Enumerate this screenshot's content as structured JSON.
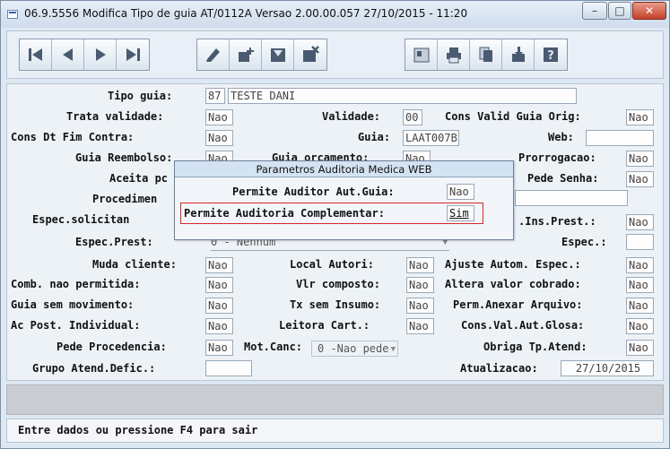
{
  "window": {
    "title": "06.9.5556  Modifica  Tipo de guia AT/0112A Versao 2.00.00.057 27/10/2015 - 11:20",
    "buttons": {
      "minimize": "–",
      "maximize": "□",
      "close": "✕"
    }
  },
  "toolbar": {
    "icons": [
      "first-record-icon",
      "previous-record-icon",
      "next-record-icon",
      "last-record-icon",
      "edit-icon",
      "add-record-icon",
      "save-icon",
      "cancel-icon",
      "view-icon",
      "print-icon",
      "copy-icon",
      "import-icon",
      "help-icon"
    ]
  },
  "form": {
    "tipo_guia": {
      "label": "Tipo guia:",
      "code": "87",
      "name": "TESTE DANI"
    },
    "trata_validade": {
      "label": "Trata validade:",
      "value": "Nao"
    },
    "validade": {
      "label": "Validade:",
      "value": "00"
    },
    "cons_valid_guia_orig": {
      "label": "Cons Valid Guia Orig:",
      "value": "Nao"
    },
    "cons_dt_fim_contra": {
      "label": "Cons Dt Fim Contra:",
      "value": "Nao"
    },
    "guia": {
      "label": "Guia:",
      "value": "LAAT007B"
    },
    "web": {
      "label": "Web:",
      "value": ""
    },
    "guia_reembolso": {
      "label": "Guia Reembolso:",
      "value": "Nao"
    },
    "guia_orcamento": {
      "label": "Guia orcamento:",
      "value": "Nao"
    },
    "prorrogacao": {
      "label": "Prorrogacao:",
      "value": "Nao"
    },
    "aceita_pc": {
      "label": "Aceita pc"
    },
    "pede_senha": {
      "label": "Pede Senha:",
      "value": "Nao"
    },
    "procedimen": {
      "label": "Procedimen"
    },
    "espec_solicitan": {
      "label": "Espec.solicitan"
    },
    "ins_prest": {
      "label": ".Ins.Prest.:",
      "value": "Nao"
    },
    "espec_prest": {
      "label": "Espec.Prest:",
      "value": "0 - Nenhum"
    },
    "espec": {
      "label": "Espec.:",
      "value": ""
    },
    "muda_cliente": {
      "label": "Muda cliente:",
      "value": "Nao"
    },
    "local_autori": {
      "label": "Local Autori:",
      "value": "Nao"
    },
    "ajuste_autom_espec": {
      "label": "Ajuste Autom. Espec.:",
      "value": "Nao"
    },
    "comb_nao_permitida": {
      "label": "Comb. nao permitida:",
      "value": "Nao"
    },
    "vlr_composto": {
      "label": "Vlr composto:",
      "value": "Nao"
    },
    "altera_valor_cobrado": {
      "label": "Altera valor cobrado:",
      "value": "Nao"
    },
    "guia_sem_movimento": {
      "label": "Guia sem movimento:",
      "value": "Nao"
    },
    "tx_sem_insumo": {
      "label": "Tx sem Insumo:",
      "value": "Nao"
    },
    "perm_anexar_arquivo": {
      "label": "Perm.Anexar Arquivo:",
      "value": "Nao"
    },
    "ac_post_individual": {
      "label": "Ac Post. Individual:",
      "value": "Nao"
    },
    "leitora_cart": {
      "label": "Leitora Cart.:",
      "value": "Nao"
    },
    "cons_val_aut_glosa": {
      "label": "Cons.Val.Aut.Glosa:",
      "value": "Nao"
    },
    "pede_procedencia": {
      "label": "Pede Procedencia:",
      "value": "Nao"
    },
    "mot_canc": {
      "label": "Mot.Canc:",
      "value": "0 -Nao pede"
    },
    "obriga_tp_atend": {
      "label": "Obriga Tp.Atend:",
      "value": "Nao"
    },
    "grupo_atend_defic": {
      "label": "Grupo Atend.Defic.:",
      "value": ""
    },
    "atualizacao": {
      "label": "Atualizacao:",
      "value": "27/10/2015"
    }
  },
  "popup": {
    "title": "Parametros Auditoria Medica WEB",
    "permite_auditor": {
      "label": "Permite Auditor Aut.Guia:",
      "value": "Nao"
    },
    "permite_auditoria": {
      "label": "Permite Auditoria Complementar:",
      "value": "Sim"
    }
  },
  "status": {
    "text": "Entre dados ou pressione F4 para sair"
  },
  "colors": {
    "highlight": "#d8262a",
    "window_bg": "#dde8f3",
    "popup_title_bg": "#d4e3f3"
  }
}
